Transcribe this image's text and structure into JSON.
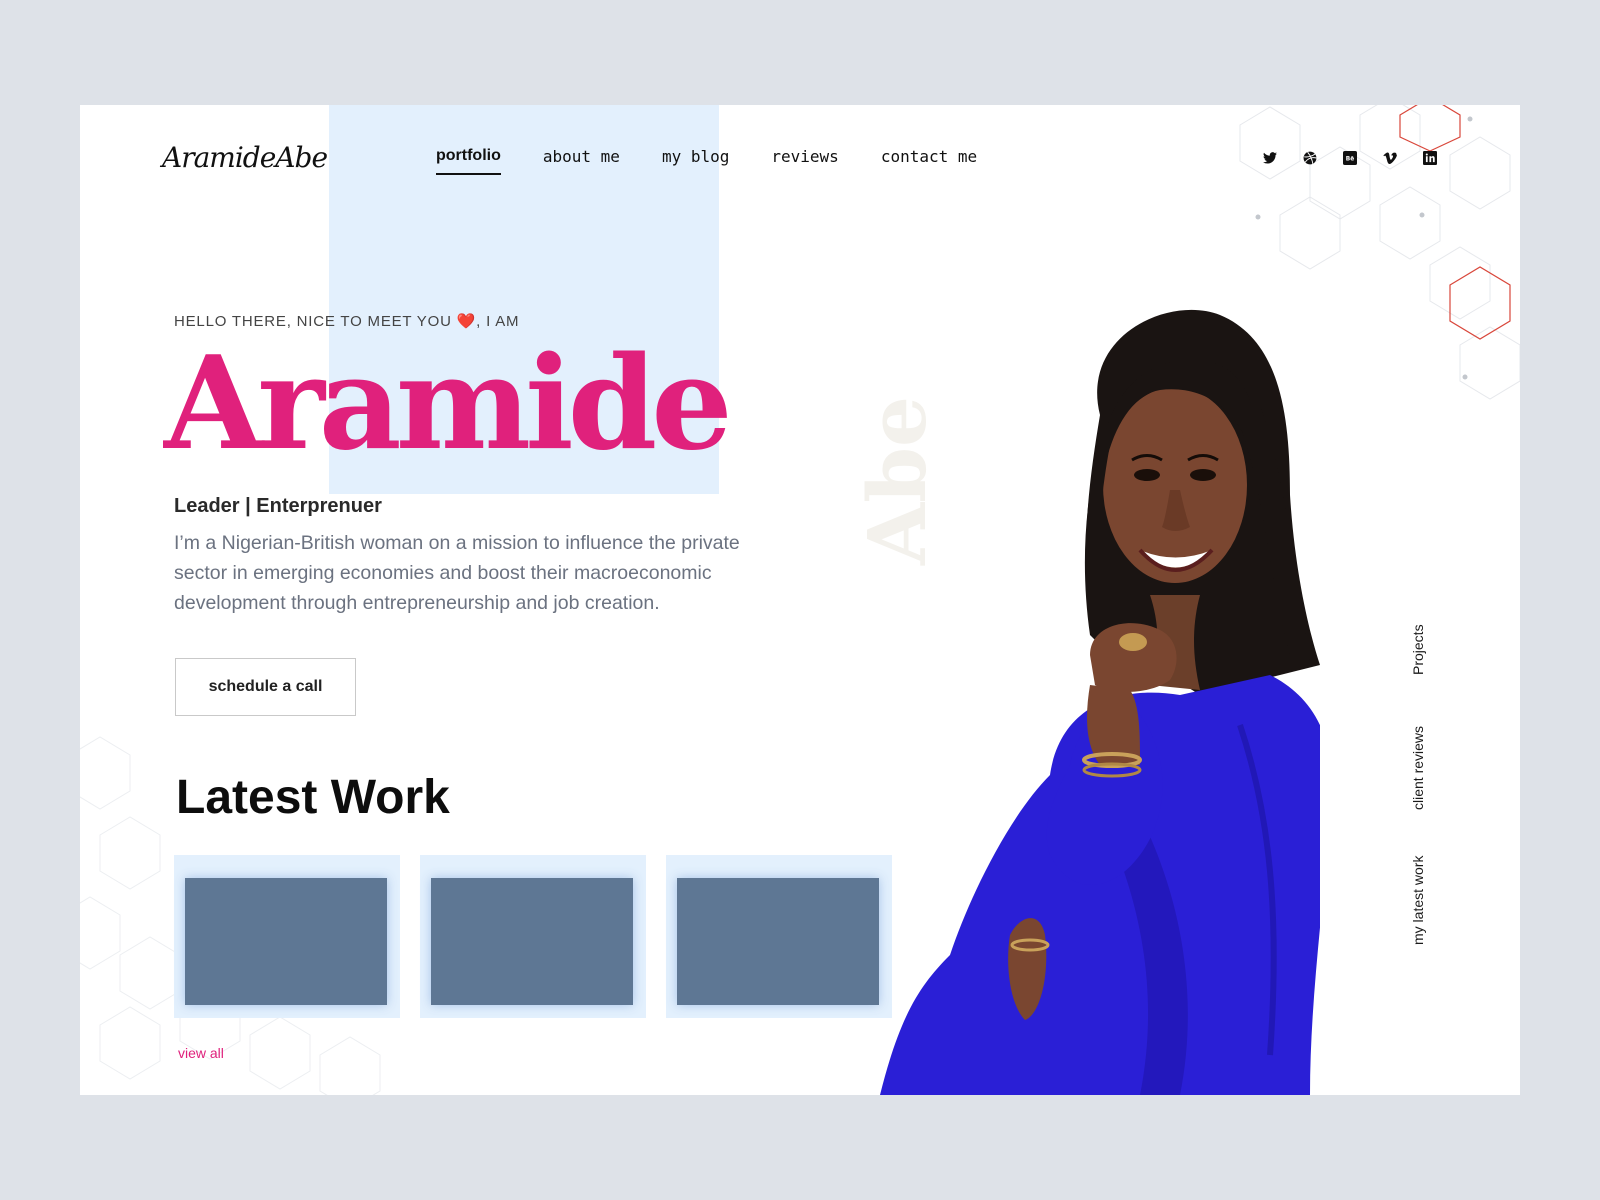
{
  "brand": {
    "logo_text": "AramideAbe"
  },
  "nav": {
    "items": [
      {
        "label": "portfolio",
        "active": true
      },
      {
        "label": "about me",
        "active": false
      },
      {
        "label": "my blog",
        "active": false
      },
      {
        "label": "reviews",
        "active": false
      },
      {
        "label": "contact me",
        "active": false
      }
    ]
  },
  "social": [
    "twitter-icon",
    "dribbble-icon",
    "behance-icon",
    "vimeo-icon",
    "linkedin-icon"
  ],
  "hero": {
    "greeting_prefix": "HELLO THERE, NICE TO MEET YOU",
    "greeting_heart": "❤️",
    "greeting_suffix": ", I AM",
    "name": "Aramide",
    "surname_vertical": "Abe",
    "subtitle": "Leader | Enterprenuer",
    "bio": "I’m a  Nigerian-British woman on a mission to influence the private sector in emerging economies and boost their macroeconomic development through entrepreneurship and job creation.",
    "cta_label": "schedule a call"
  },
  "latest_work": {
    "title": "Latest Work",
    "cards_count": 3,
    "view_all_label": "view all"
  },
  "side_links": [
    "Projects",
    "client reviews",
    "my latest work"
  ],
  "colors": {
    "accent_pink": "#e0217c",
    "light_blue": "#e3f0fd",
    "thumb_slate": "#5e7794",
    "dress_blue": "#2a1fd6",
    "page_bg": "#dee2e8"
  }
}
